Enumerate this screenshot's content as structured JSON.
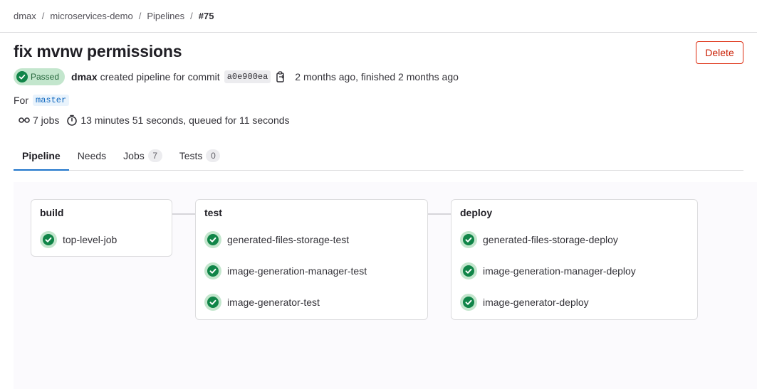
{
  "breadcrumb": {
    "items": [
      "dmax",
      "microservices-demo",
      "Pipelines"
    ],
    "current": "#75",
    "separator": "/"
  },
  "pipeline": {
    "title": "fix mvnw permissions",
    "delete_label": "Delete",
    "status_label": "Passed",
    "user": "dmax",
    "created_text": "created pipeline for commit",
    "commit_sha": "a0e900ea",
    "time_text": "2 months ago, finished 2 months ago",
    "for_label": "For",
    "branch": "master",
    "jobs_text": "7 jobs",
    "duration_text": "13 minutes 51 seconds, queued for 11 seconds"
  },
  "tabs": [
    {
      "label": "Pipeline",
      "active": true
    },
    {
      "label": "Needs"
    },
    {
      "label": "Jobs",
      "count": "7"
    },
    {
      "label": "Tests",
      "count": "0"
    }
  ],
  "stages": [
    {
      "name": "build",
      "jobs": [
        "top-level-job"
      ]
    },
    {
      "name": "test",
      "jobs": [
        "generated-files-storage-test",
        "image-generation-manager-test",
        "image-generator-test"
      ]
    },
    {
      "name": "deploy",
      "jobs": [
        "generated-files-storage-deploy",
        "image-generation-manager-deploy",
        "image-generator-deploy"
      ]
    }
  ],
  "icons": {
    "status": "status-success-icon",
    "copy": "copy-to-clipboard-icon",
    "pipeline": "pipeline-icon",
    "clock": "timer-icon"
  },
  "colors": {
    "success": "#108548",
    "success_bg": "#c3e6cd",
    "danger": "#dd2b0e",
    "active_tab": "#1f75cb"
  }
}
